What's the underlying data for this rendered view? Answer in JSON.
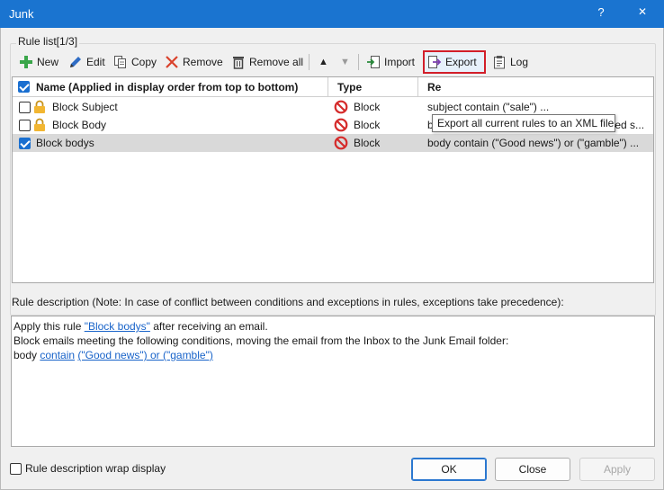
{
  "window": {
    "title": "Junk",
    "help": "?",
    "close": "✕"
  },
  "group_label": "Rule list[1/3]",
  "toolbar": {
    "new": "New",
    "edit": "Edit",
    "copy": "Copy",
    "remove": "Remove",
    "remove_all": "Remove all",
    "up": "▲",
    "down": "▼",
    "import": "Import",
    "export": "Export",
    "log": "Log"
  },
  "columns": {
    "name": "Name (Applied in display order from top to bottom)",
    "type": "Type",
    "remarks": "Re"
  },
  "rules": [
    {
      "name": "Block Subject",
      "type": "Block",
      "remark": "subject contain  (\"sale\") ..."
    },
    {
      "name": "Block Body",
      "type": "Block",
      "remark": "body contain  (\"Dear customer, we noticed s..."
    },
    {
      "name": "Block bodys",
      "type": "Block",
      "remark": "body contain  (\"Good news\") or (\"gamble\") ..."
    }
  ],
  "tooltip": "Export all current rules to an XML file.",
  "description": {
    "label": "Rule description (Note: In case of conflict between conditions and exceptions in rules, exceptions take precedence):",
    "line1_pre": "Apply this rule ",
    "line1_link": "\"Block bodys\"",
    "line1_post": " after receiving an email.",
    "line2": "Block emails meeting the following conditions, moving the email from the Inbox to the Junk Email folder:",
    "line3_pre": "body ",
    "line3_link1": "contain",
    "line3_link2": "(\"Good news\") or (\"gamble\")"
  },
  "wrap_label": "Rule description wrap display",
  "buttons": {
    "ok": "OK",
    "close": "Close",
    "apply": "Apply"
  }
}
